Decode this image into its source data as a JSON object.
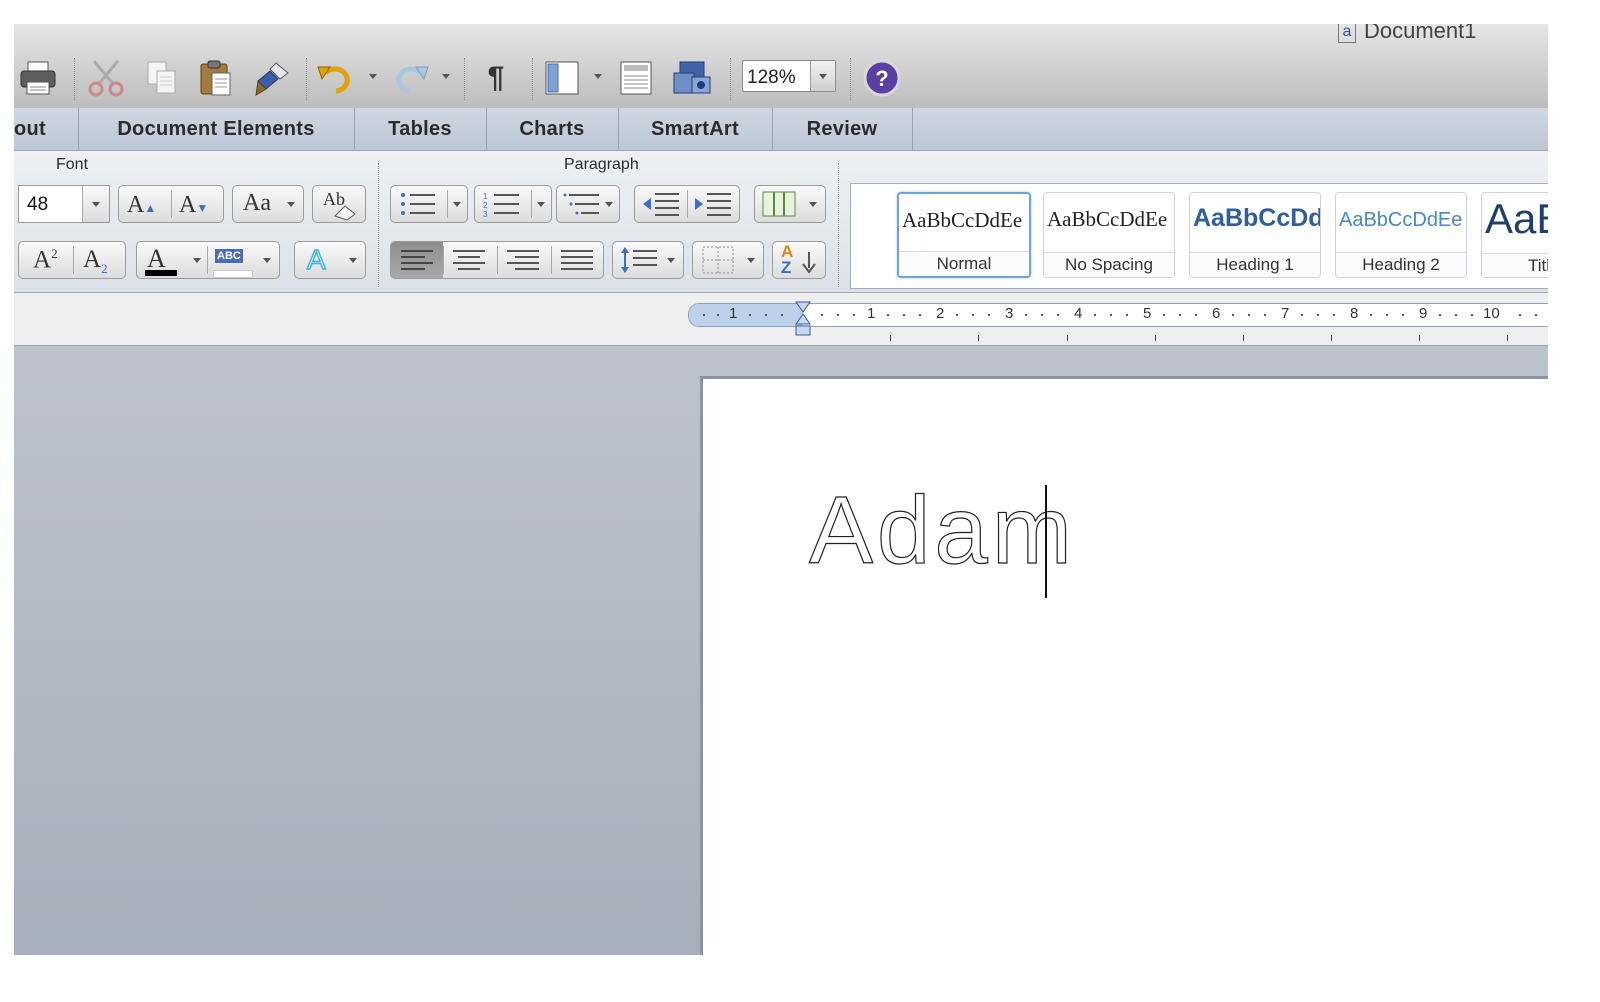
{
  "window": {
    "doc_title": "Document1"
  },
  "toolbar": {
    "zoom": "128%",
    "pilcrow": "¶"
  },
  "tabs": [
    "out",
    "Document Elements",
    "Tables",
    "Charts",
    "SmartArt",
    "Review"
  ],
  "ribbon": {
    "font_group_title": "Font",
    "paragraph_group_title": "Paragraph",
    "font_size": "48",
    "font_size_controls": {
      "grow": "A",
      "shrink": "A",
      "change_case": "Aa",
      "clear": "Ab"
    },
    "superscript": {
      "base": "A",
      "mark": "2"
    },
    "subscript": {
      "base": "A",
      "mark": "2"
    },
    "font_color": {
      "letter": "A",
      "color": "#000000"
    },
    "highlight": {
      "text": "ABC"
    },
    "text_effects": "A",
    "sort_label": {
      "top": "A",
      "bottom": "Z"
    }
  },
  "styles": [
    {
      "sample": "AaBbCcDdEe",
      "label": "Normal",
      "selected": true
    },
    {
      "sample": "AaBbCcDdEe",
      "label": "No Spacing",
      "selected": false
    },
    {
      "sample": "AaBbCcDd",
      "label": "Heading 1",
      "selected": false
    },
    {
      "sample": "AaBbCcDdEe",
      "label": "Heading 2",
      "selected": false
    },
    {
      "sample": "AaB",
      "label": "Title",
      "selected": false
    }
  ],
  "ruler": {
    "labels": [
      "1",
      "1",
      "2",
      "3",
      "4",
      "5",
      "6",
      "7",
      "8",
      "9",
      "10"
    ]
  },
  "document": {
    "text": "Adam"
  },
  "colors": {
    "accent_blue": "#6fa3de",
    "heading_blue": "#2f5f9e",
    "help_purple": "#5b3fa3"
  }
}
